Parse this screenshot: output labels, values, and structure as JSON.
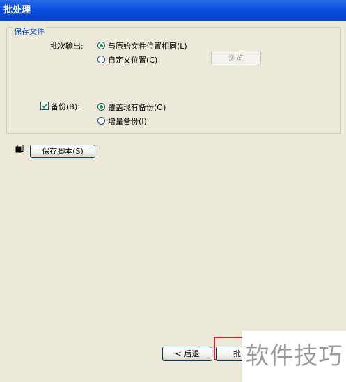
{
  "window": {
    "title": "批处理"
  },
  "group": {
    "legend": "保存文件"
  },
  "batch_output": {
    "label": "批次输出:",
    "options": [
      {
        "label": "与原始文件位置相同(L)",
        "checked": true
      },
      {
        "label": "自定义位置(C)",
        "checked": false
      }
    ],
    "browse_label": "浏览"
  },
  "backup": {
    "checkbox_label": "备份(B):",
    "checked": true,
    "options": [
      {
        "label": "覆盖现有备份(O)",
        "checked": true
      },
      {
        "label": "增量备份(I)",
        "checked": false
      }
    ]
  },
  "script": {
    "save_label": "保存脚本(S)",
    "icon": "copy-icon"
  },
  "footer": {
    "back_label": "< 后退",
    "batch_label_partial": "批"
  },
  "watermark": {
    "text": "软件技巧"
  }
}
